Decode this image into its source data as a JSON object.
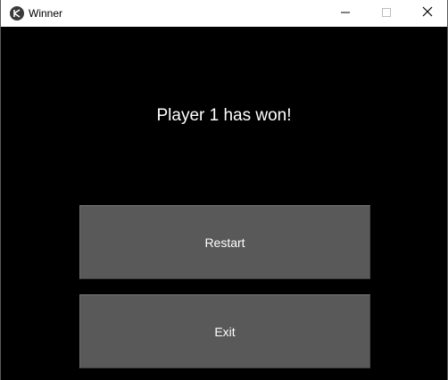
{
  "window": {
    "title": "Winner",
    "icon": "kivy-app-icon",
    "controls": {
      "minimize_icon": "minimize-icon",
      "maximize_icon": "maximize-icon",
      "close_icon": "close-icon"
    }
  },
  "main": {
    "message": "Player 1 has won!",
    "restart_label": "Restart",
    "exit_label": "Exit"
  },
  "colors": {
    "background": "#000000",
    "button": "#595959",
    "text": "#ffffff",
    "titlebar": "#ffffff"
  }
}
